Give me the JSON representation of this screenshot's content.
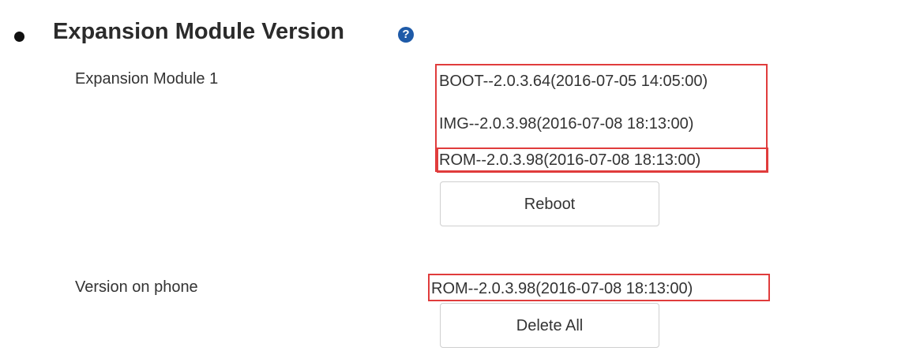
{
  "section": {
    "title": "Expansion Module Version",
    "help_icon": "?"
  },
  "module": {
    "label": "Expansion Module 1",
    "versions": {
      "boot": "BOOT--2.0.3.64(2016-07-05 14:05:00)",
      "img": "IMG--2.0.3.98(2016-07-08 18:13:00)",
      "rom": "ROM--2.0.3.98(2016-07-08 18:13:00)"
    },
    "reboot_label": "Reboot"
  },
  "phone": {
    "label": "Version on phone",
    "rom": "ROM--2.0.3.98(2016-07-08 18:13:00)",
    "delete_label": "Delete All"
  },
  "colors": {
    "highlight_border": "#e03c3c",
    "help_icon_bg": "#1e5aa8"
  }
}
